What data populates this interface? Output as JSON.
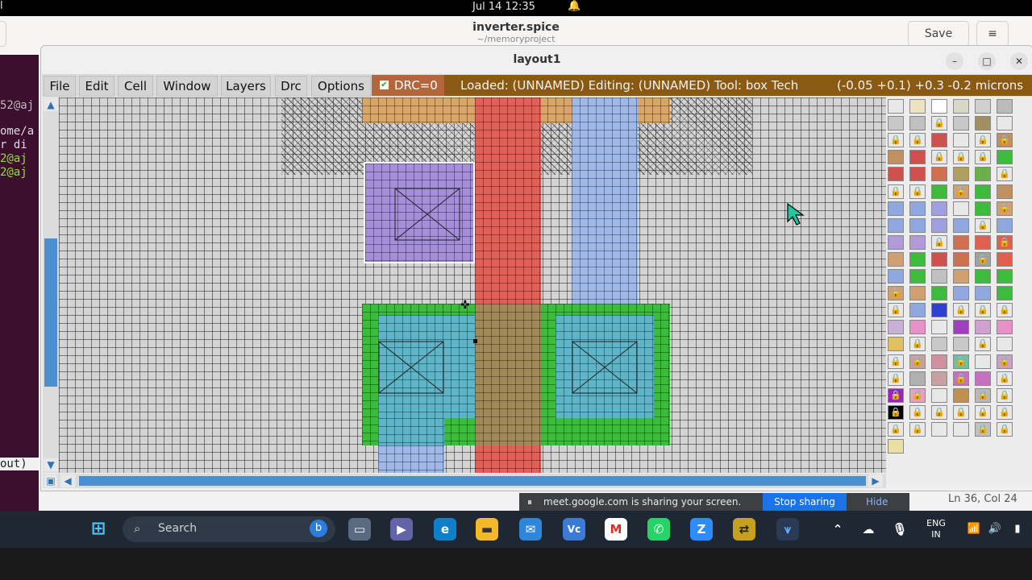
{
  "topbar": {
    "clock": "Jul 14  12:35",
    "app_frag": "l"
  },
  "gedit": {
    "title": "inverter.spice",
    "subtitle": "~/memoryproject",
    "save_label": "Save",
    "menu_icon": "≡",
    "status": "Ln 36, Col 24"
  },
  "terminal": {
    "lines": [
      "52@aj",
      "ome/a",
      "r di",
      "2@aj",
      "2@aj",
      "out)"
    ]
  },
  "magic": {
    "title": "layout1",
    "controls": {
      "min": "–",
      "max": "□",
      "close": "✕"
    },
    "menus": [
      "File",
      "Edit",
      "Cell",
      "Window",
      "Layers",
      "Drc",
      "Options"
    ],
    "drc_label": "DRC=0",
    "drc_checked": true,
    "info": "Loaded: (UNNAMED) Editing: (UNNAMED) Tool: box  Tech",
    "coords": "(-0.05 +0.1) +0.3 -0.2 microns"
  },
  "meet": {
    "message": "meet.google.com is sharing your screen.",
    "stop": "Stop sharing",
    "hide": "Hide"
  },
  "taskbar": {
    "search_placeholder": "Search",
    "lang_line1": "ENG",
    "lang_line2": "IN"
  },
  "colors": {
    "poly": "#e0605a",
    "diff": "#3dbb3d",
    "metal": "#9fb8e8",
    "contact": "#a48fd8",
    "ndiff": "#5fb4c7",
    "orange": "#d9a66a",
    "accent": "#4a8fd0"
  }
}
